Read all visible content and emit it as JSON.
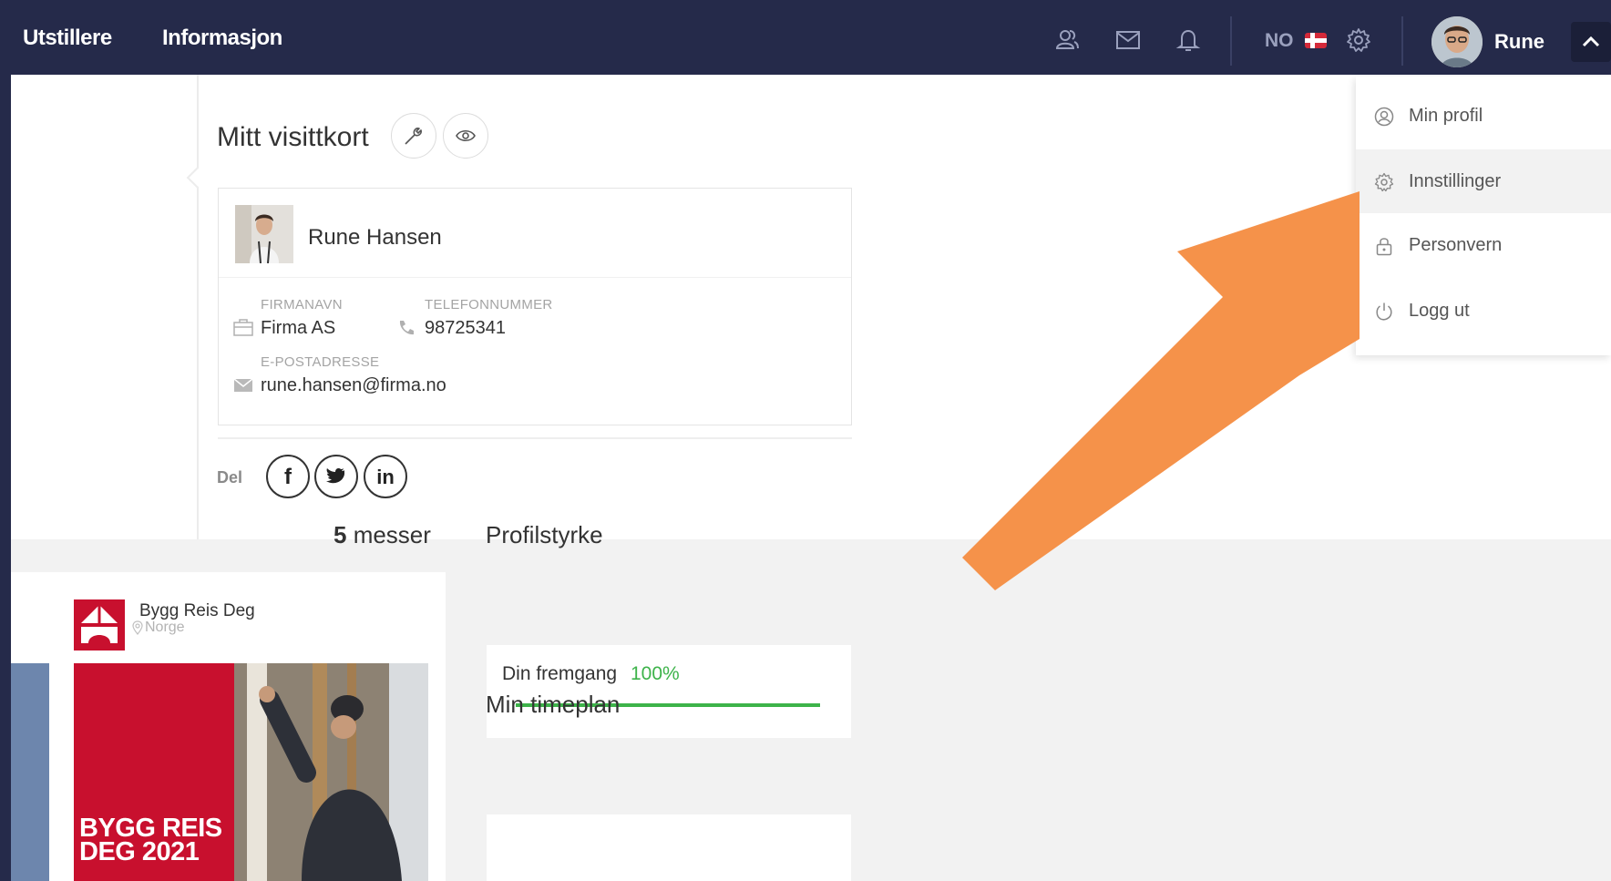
{
  "nav": {
    "links": [
      "Utstillere",
      "Informasjon"
    ],
    "language": "NO",
    "user_name": "Rune"
  },
  "card": {
    "title": "Mitt visittkort",
    "name": "Rune Hansen",
    "company_label": "FIRMANAVN",
    "company": "Firma AS",
    "phone_label": "TELEFONNUMMER",
    "phone": "98725341",
    "email_label": "E-POSTADRESSE",
    "email": "rune.hansen@firma.no",
    "share_label": "Del",
    "social": [
      "f",
      "in"
    ]
  },
  "fairs": {
    "count": "5",
    "count_suffix": " messer",
    "first": {
      "name": "Bygg Reis Deg",
      "location": "Norge",
      "banner_text": "BYGG REIS DEG 2021"
    }
  },
  "profile_strength": {
    "title": "Profilstyrke",
    "progress_label": "Din fremgang",
    "progress_value": "100%",
    "progress_fraction": 1.0
  },
  "schedule": {
    "title": "Min timeplan"
  },
  "dropdown": {
    "items": [
      "Min profil",
      "Innstillinger",
      "Personvern",
      "Logg ut"
    ],
    "active_index": 1
  },
  "colors": {
    "nav_bg": "#252a4a",
    "accent_green": "#3db34a",
    "annotation_arrow": "#f5924a",
    "brand_red": "#c8102e"
  }
}
